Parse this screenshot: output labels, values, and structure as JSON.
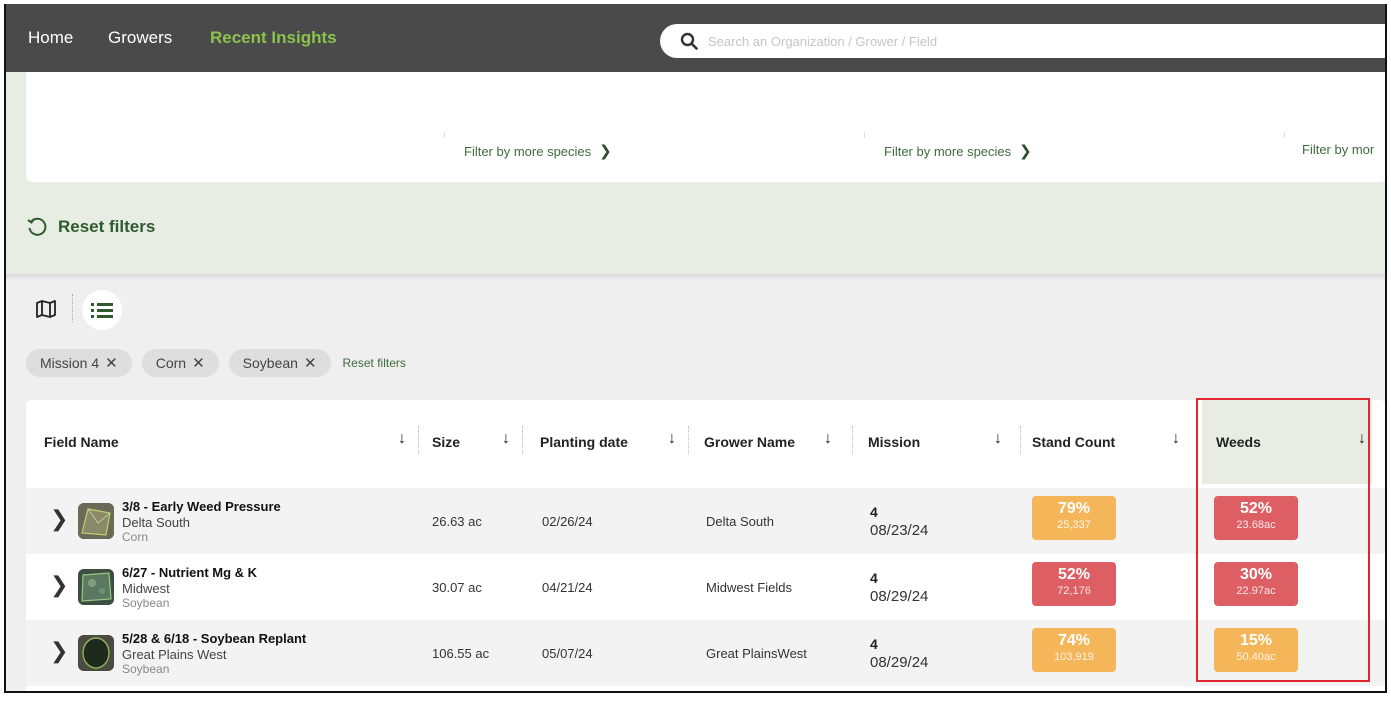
{
  "nav": {
    "items": [
      "Home",
      "Growers",
      "Recent Insights"
    ],
    "active_index": 2
  },
  "search": {
    "placeholder": "Search an Organization / Grower / Field"
  },
  "filters": {
    "species_links": [
      "Filter by more species",
      "Filter by more species",
      "Filter by mor"
    ],
    "reset_label": "Reset filters"
  },
  "chips": {
    "items": [
      "Mission 4",
      "Corn",
      "Soybean"
    ],
    "remove_glyph": "✕",
    "reset_label": "Reset filters"
  },
  "table": {
    "columns": [
      "Field Name",
      "Size",
      "Planting date",
      "Grower Name",
      "Mission",
      "Stand Count",
      "Weeds"
    ],
    "rows": [
      {
        "field_name": "3/8 - Early Weed Pressure",
        "field_grower": "Delta South",
        "crop": "Corn",
        "size": "26.63 ac",
        "planting_date": "02/26/24",
        "grower_name": "Delta South",
        "mission_num": "4",
        "mission_date": "08/23/24",
        "stand_pct": "79%",
        "stand_sub": "25,337",
        "stand_color": "#f5b65a",
        "weeds_pct": "52%",
        "weeds_sub": "23.68ac",
        "weeds_color": "#de5f63"
      },
      {
        "field_name": "6/27 - Nutrient Mg & K",
        "field_grower": "Midwest",
        "crop": "Soybean",
        "size": "30.07 ac",
        "planting_date": "04/21/24",
        "grower_name": "Midwest Fields",
        "mission_num": "4",
        "mission_date": "08/29/24",
        "stand_pct": "52%",
        "stand_sub": "72,176",
        "stand_color": "#de5f63",
        "weeds_pct": "30%",
        "weeds_sub": "22.97ac",
        "weeds_color": "#de5f63"
      },
      {
        "field_name": "5/28 & 6/18 - Soybean Replant",
        "field_grower": "Great Plains West",
        "crop": "Soybean",
        "size": "106.55 ac",
        "planting_date": "05/07/24",
        "grower_name": "Great PlainsWest",
        "mission_num": "4",
        "mission_date": "08/29/24",
        "stand_pct": "74%",
        "stand_sub": "103,919",
        "stand_color": "#f5b65a",
        "weeds_pct": "15%",
        "weeds_sub": "50.40ac",
        "weeds_color": "#f5b65a"
      }
    ]
  },
  "colors": {
    "nav_bg": "#4a4a4a",
    "accent_green": "#8bc34a",
    "highlight_red": "#e0262e"
  }
}
